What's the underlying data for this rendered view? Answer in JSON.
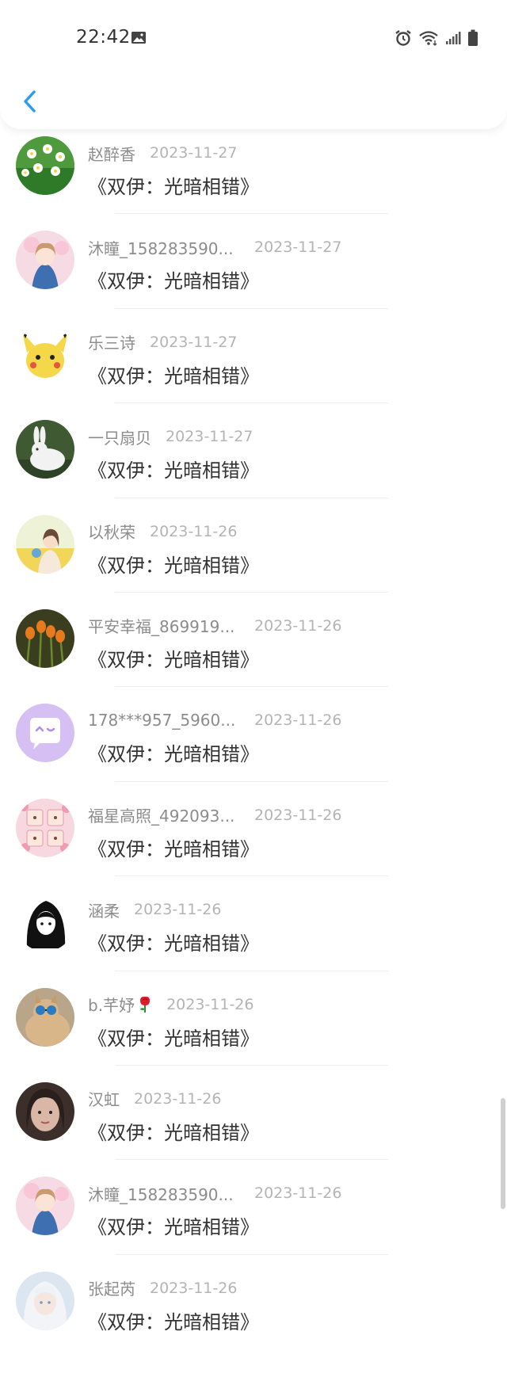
{
  "status_bar": {
    "time": "22:42",
    "icons": [
      "image-icon",
      "alarm-icon",
      "wifi-icon",
      "signal-icon",
      "battery-icon"
    ]
  },
  "header": {
    "back_icon": "chevron-left-icon",
    "accent_color": "#2b9bf0"
  },
  "items": [
    {
      "name": "赵醉香",
      "date": "2023-11-27",
      "message": "《双伊：光暗相错》",
      "avatar": "daisy-flowers"
    },
    {
      "name": "沐瞳_158283590...",
      "date": "2023-11-27",
      "message": "《双伊：光暗相错》",
      "avatar": "anime-girl-pink"
    },
    {
      "name": "乐三诗",
      "date": "2023-11-27",
      "message": "《双伊：光暗相错》",
      "avatar": "pikachu"
    },
    {
      "name": "一只扇贝",
      "date": "2023-11-27",
      "message": "《双伊：光暗相错》",
      "avatar": "white-rabbit"
    },
    {
      "name": "以秋荣",
      "date": "2023-11-26",
      "message": "《双伊：光暗相错》",
      "avatar": "girl-in-field"
    },
    {
      "name": "平安幸福_869919...",
      "date": "2023-11-26",
      "message": "《双伊：光暗相错》",
      "avatar": "orange-tulips"
    },
    {
      "name": "178***957_5960...",
      "date": "2023-11-26",
      "message": "《双伊：光暗相错》",
      "avatar": "purple-chat-bubble"
    },
    {
      "name": "福星高照_492093...",
      "date": "2023-11-26",
      "message": "《双伊：光暗相错》",
      "avatar": "baby-collage"
    },
    {
      "name": "涵柔",
      "date": "2023-11-26",
      "message": "《双伊：光暗相错》",
      "avatar": "black-anime-girl"
    },
    {
      "name": "b.芊妤",
      "date": "2023-11-26",
      "message": "《双伊：光暗相错》",
      "avatar": "cat-with-sunglasses",
      "emoji": "rose-icon"
    },
    {
      "name": "汉虹",
      "date": "2023-11-26",
      "message": "《双伊：光暗相错》",
      "avatar": "girl-portrait-dark"
    },
    {
      "name": "沐瞳_158283590...",
      "date": "2023-11-26",
      "message": "《双伊：光暗相错》",
      "avatar": "anime-girl-pink"
    },
    {
      "name": "张起芮",
      "date": "2023-11-26",
      "message": "《双伊：光暗相错》",
      "avatar": "white-haired-girl"
    }
  ]
}
